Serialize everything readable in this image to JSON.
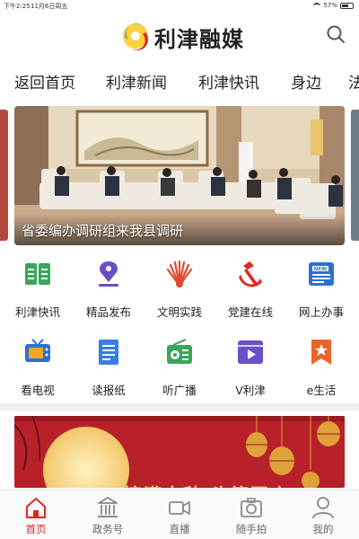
{
  "status_bar": {
    "time": "下午2:25",
    "date": "11月6日周五",
    "battery": "57%"
  },
  "header": {
    "title": "利津融媒"
  },
  "tabs": [
    {
      "label": "返回首页",
      "active": true
    },
    {
      "label": "利津新闻",
      "active": false
    },
    {
      "label": "利津快讯",
      "active": false
    },
    {
      "label": "身边",
      "active": false
    },
    {
      "label": "法",
      "active": false
    }
  ],
  "banner": {
    "caption": "省委编办调研组来我县调研"
  },
  "grid": [
    {
      "label": "利津快讯",
      "icon": "book-icon",
      "color": "#3aa65b"
    },
    {
      "label": "精品发布",
      "icon": "pen-nib-icon",
      "color": "#6a4fc7"
    },
    {
      "label": "文明实践",
      "icon": "fan-icon",
      "color": "#e04b2b"
    },
    {
      "label": "党建在线",
      "icon": "party-emblem-icon",
      "color": "#e0281d"
    },
    {
      "label": "网上办事",
      "icon": "newspaper-new-icon",
      "color": "#2e6fd6"
    },
    {
      "label": "看电视",
      "icon": "tv-icon",
      "color": "#2e6fd6"
    },
    {
      "label": "读报纸",
      "icon": "document-icon",
      "color": "#3b7de0"
    },
    {
      "label": "听广播",
      "icon": "radio-icon",
      "color": "#3aa65b"
    },
    {
      "label": "V利津",
      "icon": "video-icon",
      "color": "#6a4fc7"
    },
    {
      "label": "e生活",
      "icon": "star-badge-icon",
      "color": "#e8662c"
    }
  ],
  "promo": {
    "text": "情满中秋 头等国庆"
  },
  "bottom_nav": [
    {
      "label": "首页",
      "icon": "home-icon",
      "active": true
    },
    {
      "label": "政务号",
      "icon": "government-building-icon",
      "active": false
    },
    {
      "label": "直播",
      "icon": "live-camera-icon",
      "active": false
    },
    {
      "label": "随手拍",
      "icon": "camera-icon",
      "active": false
    },
    {
      "label": "我的",
      "icon": "user-icon",
      "active": false
    }
  ],
  "colors": {
    "accent": "#e0281d"
  }
}
